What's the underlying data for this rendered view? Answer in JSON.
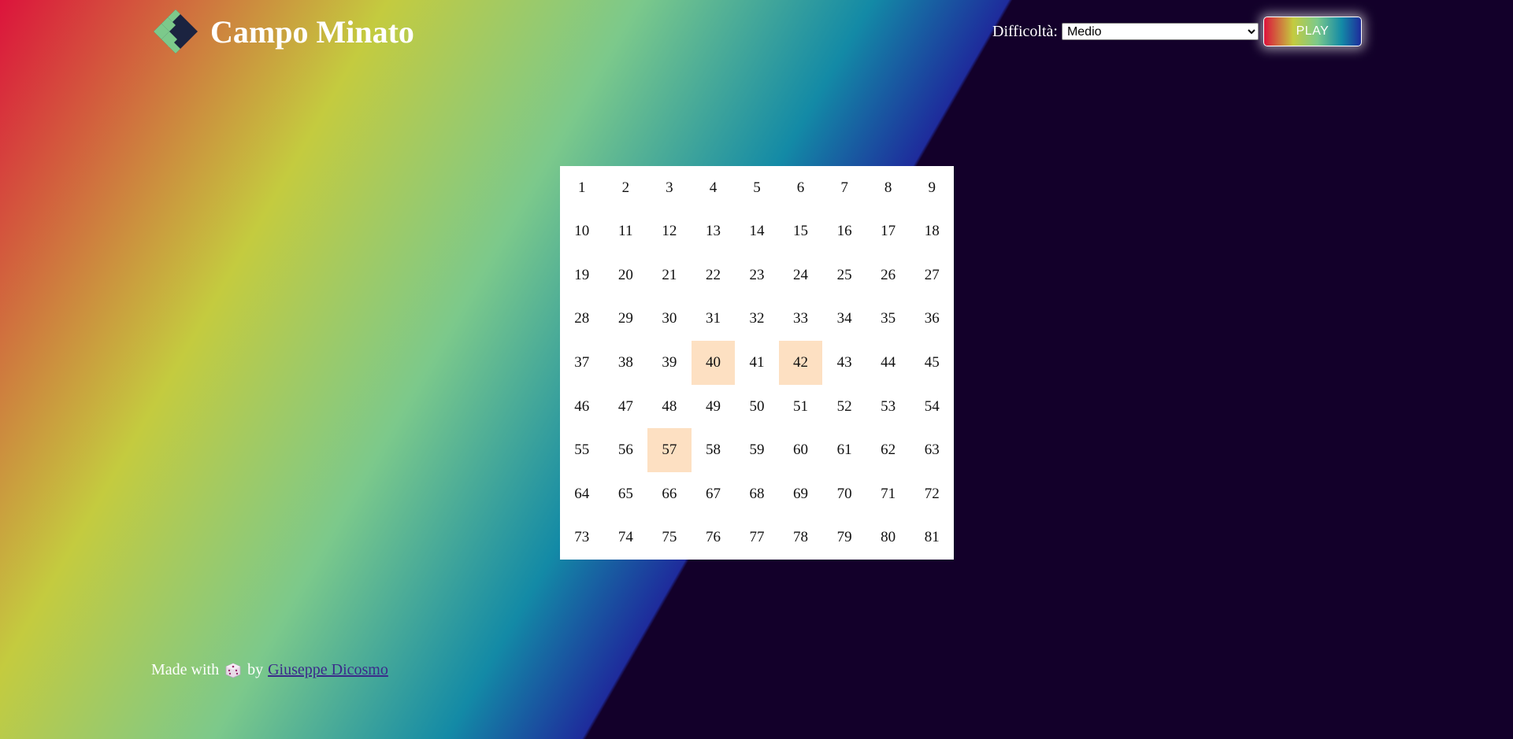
{
  "header": {
    "title": "Campo Minato",
    "difficulty_label": "Difficoltà:",
    "difficulty_selected": "Medio",
    "play_label": "PLAY",
    "logo_icon": "diamond-logo-icon"
  },
  "board": {
    "size": 9,
    "cells": [
      "1",
      "2",
      "3",
      "4",
      "5",
      "6",
      "7",
      "8",
      "9",
      "10",
      "11",
      "12",
      "13",
      "14",
      "15",
      "16",
      "17",
      "18",
      "19",
      "20",
      "21",
      "22",
      "23",
      "24",
      "25",
      "26",
      "27",
      "28",
      "29",
      "30",
      "31",
      "32",
      "33",
      "34",
      "35",
      "36",
      "37",
      "38",
      "39",
      "40",
      "41",
      "42",
      "43",
      "44",
      "45",
      "46",
      "47",
      "48",
      "49",
      "50",
      "51",
      "52",
      "53",
      "54",
      "55",
      "56",
      "57",
      "58",
      "59",
      "60",
      "61",
      "62",
      "63",
      "64",
      "65",
      "66",
      "67",
      "68",
      "69",
      "70",
      "71",
      "72",
      "73",
      "74",
      "75",
      "76",
      "77",
      "78",
      "79",
      "80",
      "81"
    ],
    "revealed": [
      "40",
      "42",
      "57"
    ],
    "revealed_color": "#fde0c2"
  },
  "footer": {
    "prefix": "Made with",
    "icon": "dice-icon",
    "by": "by",
    "author": "Giuseppe Dicosmo"
  },
  "colors": {
    "gradient": [
      "#dc143c",
      "#c4cb3f",
      "#7cc98b",
      "#138aa6",
      "#1e2b9c"
    ],
    "dark_bg": "#13002a"
  }
}
